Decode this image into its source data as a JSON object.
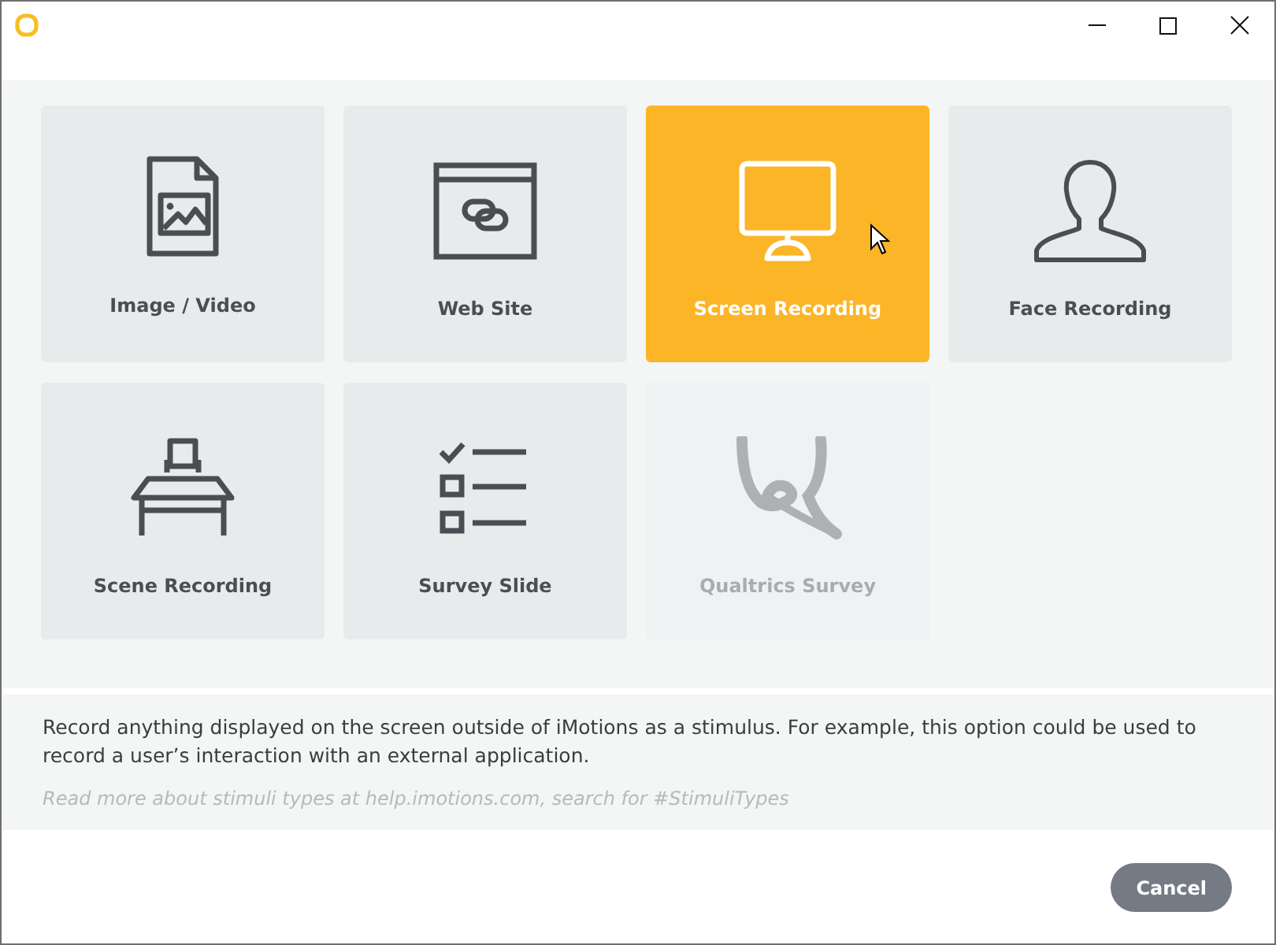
{
  "tiles": [
    {
      "kind": "image",
      "label": "Image / Video",
      "selected": false,
      "disabled": false
    },
    {
      "kind": "web",
      "label": "Web Site",
      "selected": false,
      "disabled": false
    },
    {
      "kind": "screen",
      "label": "Screen Recording",
      "selected": true,
      "disabled": false
    },
    {
      "kind": "face",
      "label": "Face Recording",
      "selected": false,
      "disabled": false
    },
    {
      "kind": "scene",
      "label": "Scene Recording",
      "selected": false,
      "disabled": false
    },
    {
      "kind": "survey",
      "label": "Survey Slide",
      "selected": false,
      "disabled": false
    },
    {
      "kind": "qualtrics",
      "label": "Qualtrics Survey",
      "selected": false,
      "disabled": true
    }
  ],
  "description": "Record anything displayed on the screen outside of iMotions as a stimulus. For example, this option could be used to record a user’s interaction with an external application.",
  "help_text": "Read more about stimuli types at help.imotions.com, search for #StimuliTypes",
  "buttons": [
    "Cancel"
  ]
}
